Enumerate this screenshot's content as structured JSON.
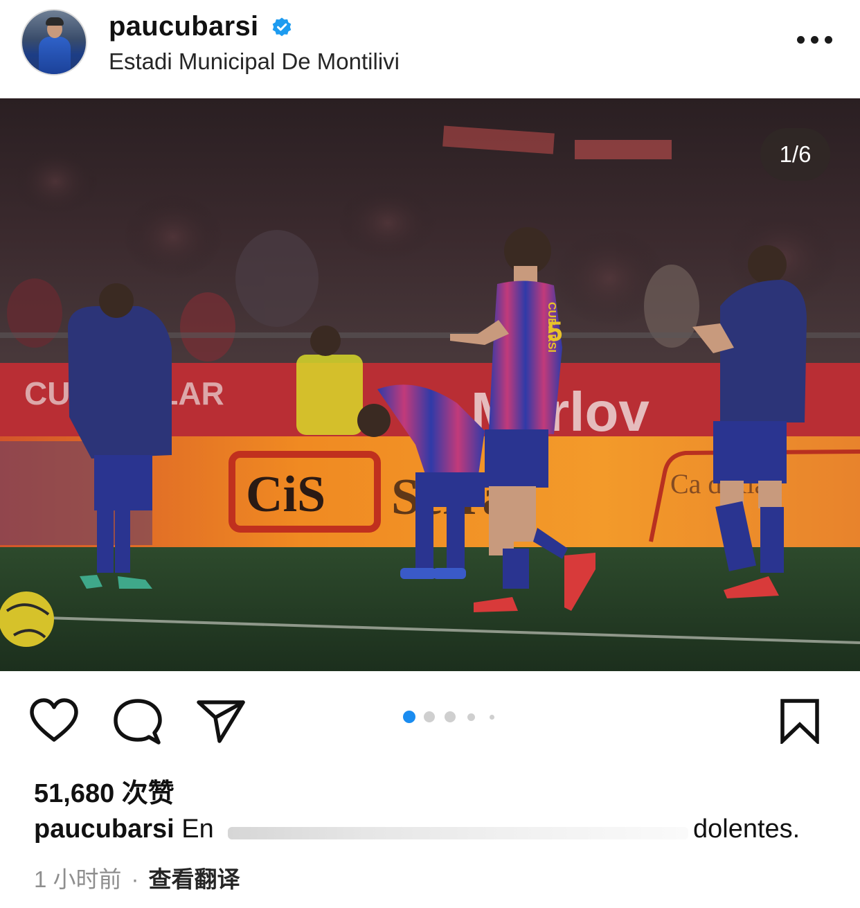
{
  "post": {
    "username": "paucubarsi",
    "location": "Estadi Municipal De Montilivi",
    "image_counter": "1/6",
    "carousel": {
      "total_dots": 5,
      "active_index": 0
    },
    "likes_text": "51,680 次赞",
    "caption": {
      "username": "paucubarsi",
      "text_start": "En",
      "text_end": "dolentes."
    },
    "time_ago": "1 小时前",
    "separator": "·",
    "translate_label": "查看翻译"
  },
  "photo": {
    "board_text_left": "CUI OCULAR",
    "board_text_center": "CiS",
    "board_text_center2": "Sefra",
    "board_text_right": "Ca d'Ala",
    "jersey_name": "CUBARSI",
    "jersey_number": "5"
  },
  "icons": {
    "like": "heart-icon",
    "comment": "comment-icon",
    "share": "send-icon",
    "save": "bookmark-icon",
    "more": "more-icon",
    "verified": "verified-badge-icon"
  },
  "colors": {
    "active_dot": "#1a8cf0",
    "verified": "#1d9bf0",
    "text": "#111111",
    "secondary_text": "#8e8e8e"
  }
}
